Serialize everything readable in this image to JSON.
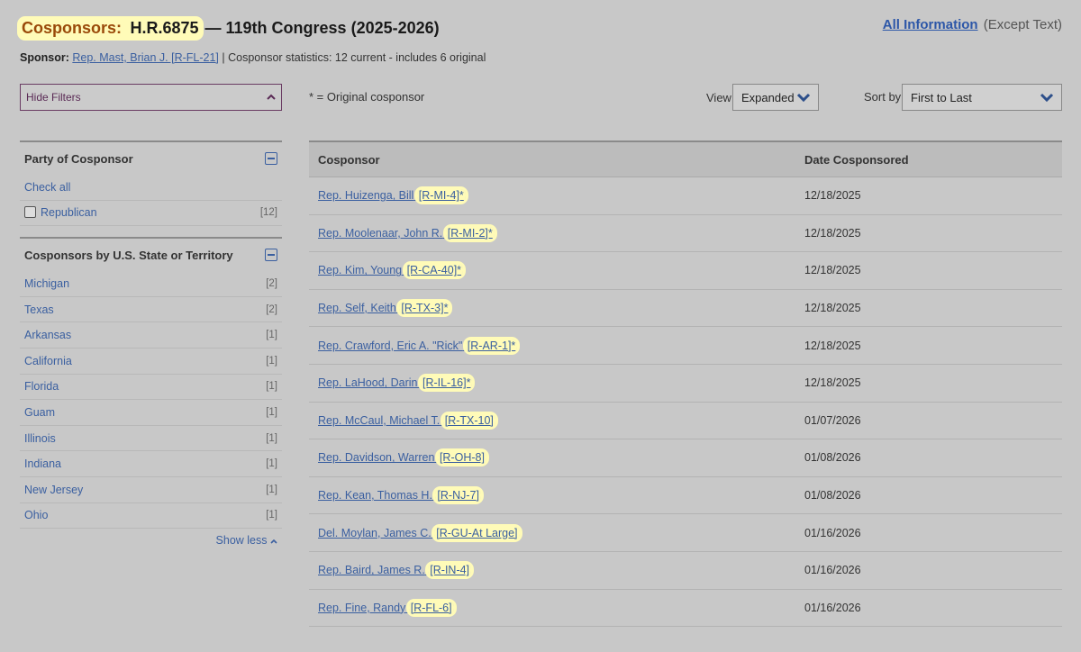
{
  "header": {
    "title_prefix": "Cosponsors:",
    "bill": "H.R.6875",
    "congress": "— 119th Congress (2025-2026)",
    "all_info_link": "All Information",
    "all_info_rest": "(Except Text)"
  },
  "sponsor": {
    "label": "Sponsor:",
    "name": "Rep. Mast, Brian J. [R-FL-21]",
    "stats": "| Cosponsor statistics: 12 current - includes 6 original"
  },
  "controls": {
    "hide_filters": "Hide Filters",
    "original_note": "* = Original cosponsor",
    "view_label": "View",
    "view_value": "Expanded",
    "sort_label": "Sort by",
    "sort_value": "First to Last"
  },
  "filters": {
    "party": {
      "heading": "Party of Cosponsor",
      "check_all": "Check all",
      "items": [
        {
          "label": "Republican",
          "count": "[12]"
        }
      ]
    },
    "state": {
      "heading": "Cosponsors by U.S. State or Territory",
      "items": [
        {
          "label": "Michigan",
          "count": "[2]"
        },
        {
          "label": "Texas",
          "count": "[2]"
        },
        {
          "label": "Arkansas",
          "count": "[1]"
        },
        {
          "label": "California",
          "count": "[1]"
        },
        {
          "label": "Florida",
          "count": "[1]"
        },
        {
          "label": "Guam",
          "count": "[1]"
        },
        {
          "label": "Illinois",
          "count": "[1]"
        },
        {
          "label": "Indiana",
          "count": "[1]"
        },
        {
          "label": "New Jersey",
          "count": "[1]"
        },
        {
          "label": "Ohio",
          "count": "[1]"
        }
      ],
      "show_less": "Show less"
    }
  },
  "table": {
    "headers": [
      "Cosponsor",
      "Date Cosponsored"
    ],
    "rows": [
      {
        "name": "Rep. Huizenga, Bill",
        "tag": "[R-MI-4]*",
        "date": "12/18/2025"
      },
      {
        "name": "Rep. Moolenaar, John R.",
        "tag": "[R-MI-2]*",
        "date": "12/18/2025"
      },
      {
        "name": "Rep. Kim, Young",
        "tag": "[R-CA-40]*",
        "date": "12/18/2025"
      },
      {
        "name": "Rep. Self, Keith",
        "tag": "[R-TX-3]*",
        "date": "12/18/2025"
      },
      {
        "name": "Rep. Crawford, Eric A. \"Rick\"",
        "tag": "[R-AR-1]*",
        "date": "12/18/2025"
      },
      {
        "name": "Rep. LaHood, Darin",
        "tag": "[R-IL-16]*",
        "date": "12/18/2025"
      },
      {
        "name": "Rep. McCaul, Michael T.",
        "tag": "[R-TX-10]",
        "date": "01/07/2026"
      },
      {
        "name": "Rep. Davidson, Warren",
        "tag": "[R-OH-8]",
        "date": "01/08/2026"
      },
      {
        "name": "Rep. Kean, Thomas H.",
        "tag": "[R-NJ-7]",
        "date": "01/08/2026"
      },
      {
        "name": "Del. Moylan, James C.",
        "tag": "[R-GU-At Large]",
        "date": "01/16/2026"
      },
      {
        "name": "Rep. Baird, James R.",
        "tag": "[R-IN-4]",
        "date": "01/16/2026"
      },
      {
        "name": "Rep. Fine, Randy",
        "tag": "[R-FL-6]",
        "date": "01/16/2026"
      }
    ]
  },
  "colors": {
    "link": "#3a5fa0",
    "highlight": "#fffbb8",
    "title_accent": "#9a4a0a",
    "background": "#c8c8c8"
  }
}
